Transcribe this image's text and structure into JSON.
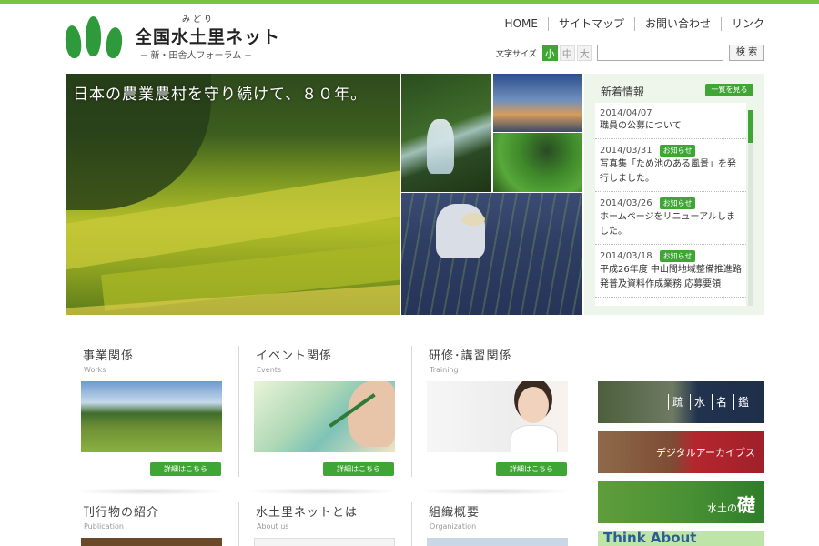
{
  "site": {
    "name": "全国水土里ネット",
    "ruby": "みどり",
    "tagline": "− 新・田舎人フォーラム −"
  },
  "nav": {
    "items": [
      "HOME",
      "サイトマップ",
      "お問い合わせ",
      "リンク"
    ]
  },
  "font_size": {
    "label": "文字サイズ",
    "options": [
      "小",
      "中",
      "大"
    ],
    "selected": "小"
  },
  "search": {
    "value": "",
    "button": "検 索"
  },
  "hero": {
    "caption": "日本の農業農村を守り続けて、８０年。"
  },
  "news": {
    "heading": "新着情報",
    "more": "一覧を見る",
    "items": [
      {
        "date": "2014/04/07",
        "badge": "",
        "title": "職員の公募について"
      },
      {
        "date": "2014/03/31",
        "badge": "お知らせ",
        "title": "写真集「ため池のある風景」を発行しました。"
      },
      {
        "date": "2014/03/26",
        "badge": "お知らせ",
        "title": "ホームページをリニューアルしました。"
      },
      {
        "date": "2014/03/18",
        "badge": "お知らせ",
        "title": "平成26年度 中山間地域整備推進路発普及資料作成業務 応募要領"
      }
    ]
  },
  "cards": [
    {
      "title": "事業関係",
      "en": "Works",
      "detail": "詳細はこちら"
    },
    {
      "title": "イベント関係",
      "en": "Events",
      "detail": "詳細はこちら"
    },
    {
      "title": "研修･講習関係",
      "en": "Training",
      "detail": "詳細はこちら"
    },
    {
      "title": "刊行物の紹介",
      "en": "Publication"
    },
    {
      "title": "水土里ネットとは",
      "en": "About us"
    },
    {
      "title": "組織概要",
      "en": "Organization"
    }
  ],
  "banners": {
    "b1": [
      "疏",
      "水",
      "名",
      "鑑"
    ],
    "b2": "デジタルアーカイブス",
    "b3_prefix": "水土の",
    "b3_big": "礎",
    "b4": "Think About"
  },
  "colors": {
    "accent": "#3fa535",
    "topbar": "#7cc243",
    "news_bg": "#eef6ec"
  }
}
